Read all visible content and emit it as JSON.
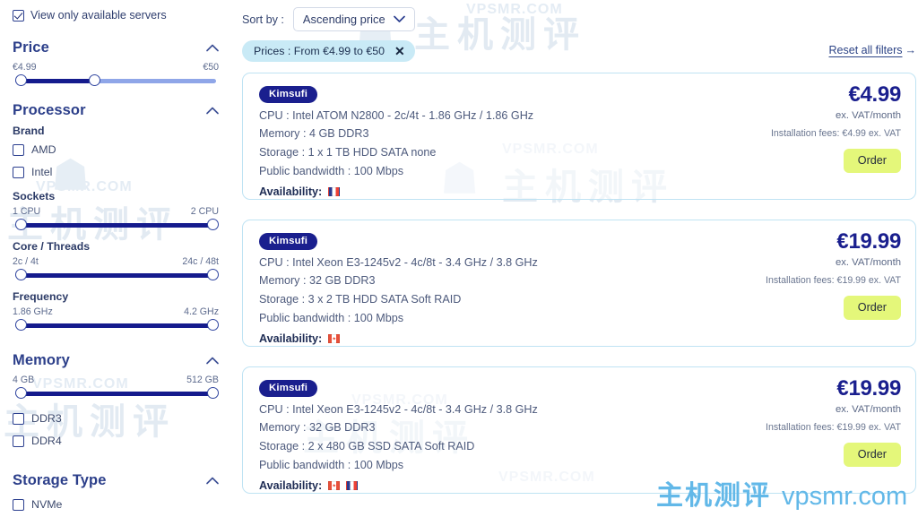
{
  "sidebar": {
    "available_only": {
      "label": "View only available servers",
      "checked": true
    },
    "sections": [
      {
        "id": "price",
        "title": "Price",
        "collapse_icon": "chevron-up-icon",
        "range": {
          "min_label": "€4.99",
          "max_label": "€50",
          "fill_start_pct": 0,
          "fill_end_pct": 38
        }
      },
      {
        "id": "processor",
        "title": "Processor",
        "collapse_icon": "chevron-up-icon",
        "brand_label": "Brand",
        "brands": [
          {
            "label": "AMD",
            "checked": false
          },
          {
            "label": "Intel",
            "checked": false
          }
        ],
        "sliders": [
          {
            "label": "Sockets",
            "min_label": "1 CPU",
            "max_label": "2 CPU",
            "fill_start_pct": 0,
            "fill_end_pct": 100
          },
          {
            "label": "Core / Threads",
            "min_label": "2c / 4t",
            "max_label": "24c / 48t",
            "fill_start_pct": 0,
            "fill_end_pct": 100
          },
          {
            "label": "Frequency",
            "min_label": "1.86 GHz",
            "max_label": "4.2 GHz",
            "fill_start_pct": 0,
            "fill_end_pct": 100
          }
        ]
      },
      {
        "id": "memory",
        "title": "Memory",
        "collapse_icon": "chevron-up-icon",
        "range": {
          "min_label": "4 GB",
          "max_label": "512 GB",
          "fill_start_pct": 0,
          "fill_end_pct": 100
        },
        "options": [
          {
            "label": "DDR3",
            "checked": false
          },
          {
            "label": "DDR4",
            "checked": false
          }
        ]
      },
      {
        "id": "storage-type",
        "title": "Storage Type",
        "collapse_icon": "chevron-up-icon",
        "options": [
          {
            "label": "NVMe",
            "checked": false
          }
        ]
      }
    ]
  },
  "main": {
    "sort": {
      "label": "Sort by :",
      "selected": "Ascending price",
      "dropdown_icon": "chevron-down-icon"
    },
    "filter_chip": {
      "label": "Prices : From €4.99 to €50",
      "remove_icon": "close-icon"
    },
    "reset_filters": {
      "label": "Reset all filters",
      "arrow": "→"
    },
    "cards": [
      {
        "badge": "Kimsufi",
        "cpu": "CPU : Intel ATOM N2800 - 2c/4t - 1.86 GHz / 1.86 GHz",
        "memory": "Memory : 4 GB DDR3",
        "storage": "Storage : 1 x 1 TB HDD SATA none",
        "bandwidth": "Public bandwidth : 100 Mbps",
        "availability_label": "Availability:",
        "flags": [
          "fr"
        ],
        "price": "€4.99",
        "price_sub": "ex. VAT/month",
        "install": "Installation fees: €4.99 ex. VAT",
        "order_label": "Order"
      },
      {
        "badge": "Kimsufi",
        "cpu": "CPU : Intel Xeon E3-1245v2 - 4c/8t - 3.4 GHz / 3.8 GHz",
        "memory": "Memory : 32 GB DDR3",
        "storage": "Storage : 3 x 2 TB HDD SATA Soft RAID",
        "bandwidth": "Public bandwidth : 100 Mbps",
        "availability_label": "Availability:",
        "flags": [
          "ca"
        ],
        "price": "€19.99",
        "price_sub": "ex. VAT/month",
        "install": "Installation fees: €19.99 ex. VAT",
        "order_label": "Order"
      },
      {
        "badge": "Kimsufi",
        "cpu": "CPU : Intel Xeon E3-1245v2 - 4c/8t - 3.4 GHz / 3.8 GHz",
        "memory": "Memory : 32 GB DDR3",
        "storage": "Storage : 2 x 480 GB SSD SATA Soft RAID",
        "bandwidth": "Public bandwidth : 100 Mbps",
        "availability_label": "Availability:",
        "flags": [
          "ca",
          "fr"
        ],
        "price": "€19.99",
        "price_sub": "ex. VAT/month",
        "install": "Installation fees: €19.99 ex. VAT",
        "order_label": "Order"
      }
    ]
  },
  "watermarks": {
    "cn_text": "主机测评",
    "domain_text": "VPSMR.COM",
    "bottom_cn": "主机测评",
    "bottom_domain": "vpsmr.com"
  },
  "colors": {
    "brand_navy": "#1a1f8e",
    "chip_blue": "#c9eaf6",
    "order_lime": "#e4f77a",
    "card_border": "#bfe3f3",
    "watermark_blue": "#62b8e8"
  }
}
